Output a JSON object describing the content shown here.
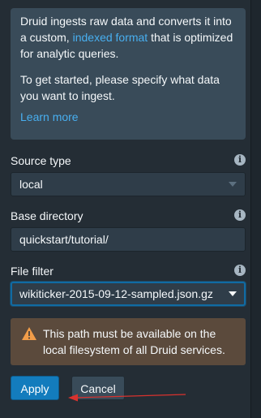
{
  "intro": {
    "text_before_link": "Druid ingests raw data and converts it into a custom, ",
    "link_text": "indexed format",
    "text_after_link": " that is optimized for analytic queries.",
    "get_started": "To get started, please specify what data you want to ingest.",
    "learn_more": "Learn more"
  },
  "source_type": {
    "label": "Source type",
    "value": "local",
    "info_icon": "info-icon"
  },
  "base_directory": {
    "label": "Base directory",
    "value": "quickstart/tutorial/",
    "info_icon": "info-icon"
  },
  "file_filter": {
    "label": "File filter",
    "value": "wikiticker-2015-09-12-sampled.json.gz",
    "info_icon": "info-icon"
  },
  "warning": {
    "icon": "warning-icon",
    "text": "This path must be available on the local filesystem of all Druid services."
  },
  "buttons": {
    "apply": "Apply",
    "cancel": "Cancel"
  },
  "colors": {
    "panel_bg": "#242d35",
    "card_bg": "#394b59",
    "link": "#48aff0",
    "primary": "#137cbd",
    "warning_bg": "#5b4a3c",
    "warning_icon": "#f29d49",
    "annotation_arrow": "#d9322e"
  }
}
